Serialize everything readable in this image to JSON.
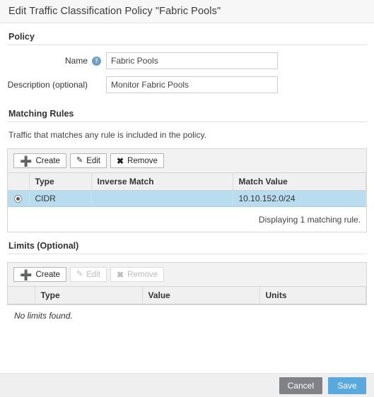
{
  "dialog": {
    "title": "Edit Traffic Classification Policy \"Fabric Pools\""
  },
  "policy": {
    "section_label": "Policy",
    "name_label": "Name",
    "name_help_icon": "question-mark-icon",
    "name_value": "Fabric Pools",
    "name_placeholder": "",
    "description_label": "Description (optional)",
    "description_value": "Monitor Fabric Pools",
    "description_placeholder": ""
  },
  "matching_rules": {
    "section_label": "Matching Rules",
    "hint": "Traffic that matches any rule is included in the policy.",
    "toolbar": {
      "create_label": "Create",
      "create_icon": "plus-icon",
      "edit_label": "Edit",
      "edit_icon": "pencil-icon",
      "remove_label": "Remove",
      "remove_icon": "x-icon"
    },
    "columns": [
      "Type",
      "Inverse Match",
      "Match Value"
    ],
    "rows": [
      {
        "selected": true,
        "type": "CIDR",
        "inverse_match": "",
        "match_value": "10.10.152.0/24"
      }
    ],
    "footer_text": "Displaying 1 matching rule."
  },
  "limits": {
    "section_label": "Limits (Optional)",
    "toolbar": {
      "create_label": "Create",
      "create_icon": "plus-icon",
      "edit_label": "Edit",
      "edit_icon": "pencil-icon",
      "remove_label": "Remove",
      "remove_icon": "x-icon"
    },
    "columns": [
      "Type",
      "Value",
      "Units"
    ],
    "empty_text": "No limits found."
  },
  "footer": {
    "cancel_label": "Cancel",
    "save_label": "Save"
  },
  "colors": {
    "accent_blue": "#5aa9de",
    "cancel_gray": "#808285",
    "row_selected": "#b9dcee",
    "help_icon_blue": "#6b9fc4"
  }
}
